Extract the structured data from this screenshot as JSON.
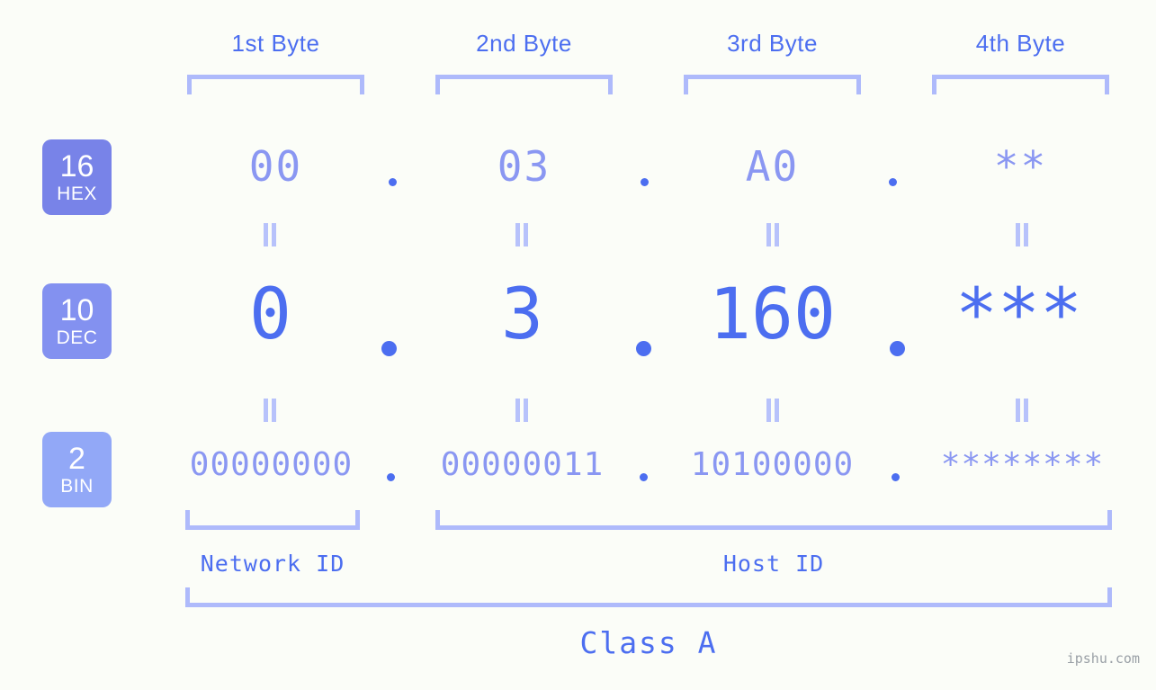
{
  "page": {
    "background_color": "#fbfdf8",
    "accent_color": "#4c6ef0",
    "light_accent_color": "#aebafb",
    "mid_accent_color": "#8a97f2"
  },
  "byte_headers": [
    {
      "label": "1st Byte"
    },
    {
      "label": "2nd Byte"
    },
    {
      "label": "3rd Byte"
    },
    {
      "label": "4th Byte"
    }
  ],
  "rows": {
    "hex": {
      "badge_number": "16",
      "badge_name": "HEX",
      "badge_color": "#7883e8",
      "values": [
        "00",
        "03",
        "A0",
        "**"
      ],
      "separators": [
        ".",
        ".",
        "."
      ]
    },
    "dec": {
      "badge_number": "10",
      "badge_name": "DEC",
      "badge_color": "#8391f0",
      "values": [
        "0",
        "3",
        "160",
        "***"
      ],
      "separators": [
        ".",
        ".",
        "."
      ]
    },
    "bin": {
      "badge_number": "2",
      "badge_name": "BIN",
      "badge_color": "#92a8f7",
      "values": [
        "00000000",
        "00000011",
        "10100000",
        "********"
      ],
      "separators": [
        ".",
        ".",
        "."
      ]
    }
  },
  "footer": {
    "network_id_label": "Network ID",
    "host_id_label": "Host ID",
    "class_label": "Class A",
    "watermark": "ipshu.com"
  }
}
